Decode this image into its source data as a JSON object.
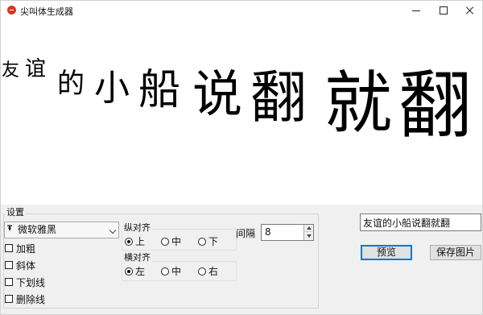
{
  "window": {
    "title": "尖叫体生成器",
    "accent_color": "#d9352b",
    "controls": [
      "minimize-icon",
      "maximize-icon",
      "close-icon"
    ]
  },
  "preview": {
    "characters": [
      {
        "text": "友",
        "size_level": 1
      },
      {
        "text": "谊",
        "size_level": 2
      },
      {
        "text": "的",
        "size_level": 3
      },
      {
        "text": "小",
        "size_level": 4
      },
      {
        "text": "船",
        "size_level": 5
      },
      {
        "text": "说",
        "size_level": 6
      },
      {
        "text": "翻",
        "size_level": 7
      },
      {
        "text": "就",
        "size_level": 8
      },
      {
        "text": "翻",
        "size_level": 9
      }
    ]
  },
  "settings": {
    "group_label": "设置",
    "font": {
      "icon": "font-icon",
      "selected": "微软雅黑"
    },
    "styles": [
      {
        "label": "加粗",
        "checked": false
      },
      {
        "label": "斜体",
        "checked": false
      },
      {
        "label": "下划线",
        "checked": false
      },
      {
        "label": "删除线",
        "checked": false
      }
    ],
    "vertical_align": {
      "label": "纵对齐",
      "options": [
        {
          "label": "上",
          "checked": true
        },
        {
          "label": "中",
          "checked": false
        },
        {
          "label": "下",
          "checked": false
        }
      ]
    },
    "horizontal_align": {
      "label": "横对齐",
      "options": [
        {
          "label": "左",
          "checked": true
        },
        {
          "label": "中",
          "checked": false
        },
        {
          "label": "右",
          "checked": false
        }
      ]
    },
    "spacing": {
      "label": "间隔",
      "value": "8"
    }
  },
  "actions": {
    "input_text": "友谊的小船说翻就翻",
    "preview_label": "预览",
    "save_label": "保存图片"
  }
}
